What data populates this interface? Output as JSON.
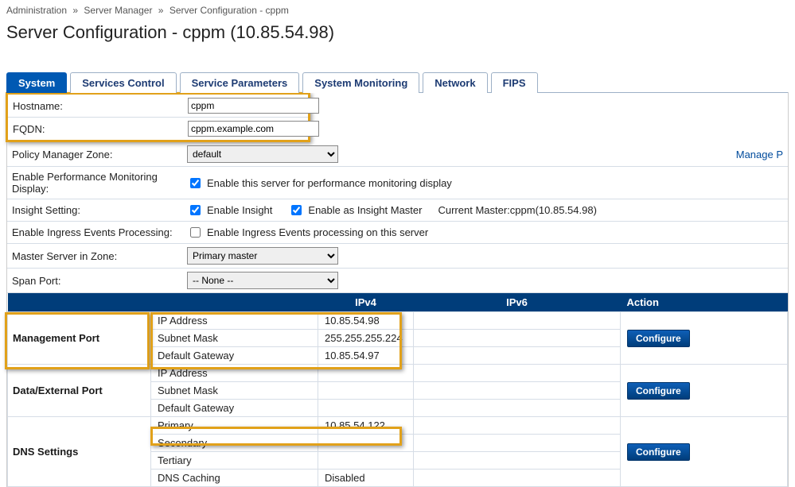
{
  "breadcrumb": {
    "admin": "Administration",
    "server_manager": "Server Manager",
    "current": "Server Configuration - cppm",
    "sep": "»"
  },
  "page_title": "Server Configuration - cppm (10.85.54.98)",
  "tabs": {
    "system": "System",
    "services_control": "Services Control",
    "service_parameters": "Service Parameters",
    "system_monitoring": "System Monitoring",
    "network": "Network",
    "fips": "FIPS"
  },
  "form": {
    "hostname_label": "Hostname:",
    "hostname_value": "cppm",
    "fqdn_label": "FQDN:",
    "fqdn_value": "cppm.example.com",
    "zone_label": "Policy Manager Zone:",
    "zone_value": "default",
    "manage_zones": "Manage P",
    "perf_label": "Enable Performance Monitoring Display:",
    "perf_check_label": "Enable this server for performance monitoring display",
    "insight_label": "Insight Setting:",
    "insight_enable": "Enable Insight",
    "insight_master": "Enable as Insight Master",
    "insight_current": "Current Master:cppm(10.85.54.98)",
    "ingress_label": "Enable Ingress Events Processing:",
    "ingress_check_label": "Enable Ingress Events processing on this server",
    "master_label": "Master Server in Zone:",
    "master_value": "Primary master",
    "span_label": "Span Port:",
    "span_value": "-- None --"
  },
  "net_headers": {
    "ipv4": "IPv4",
    "ipv6": "IPv6",
    "action": "Action"
  },
  "net_rows": {
    "mgmt": {
      "section": "Management Port",
      "ip_label": "IP Address",
      "ip_value": "10.85.54.98",
      "mask_label": "Subnet Mask",
      "mask_value": "255.255.255.224",
      "gw_label": "Default Gateway",
      "gw_value": "10.85.54.97"
    },
    "data": {
      "section": "Data/External Port",
      "ip_label": "IP Address",
      "mask_label": "Subnet Mask",
      "gw_label": "Default Gateway"
    },
    "dns": {
      "section": "DNS Settings",
      "primary_label": "Primary",
      "primary_value": "10.85.54.122",
      "secondary_label": "Secondary",
      "tertiary_label": "Tertiary",
      "caching_label": "DNS Caching",
      "caching_value": "Disabled"
    },
    "configure": "Configure"
  }
}
